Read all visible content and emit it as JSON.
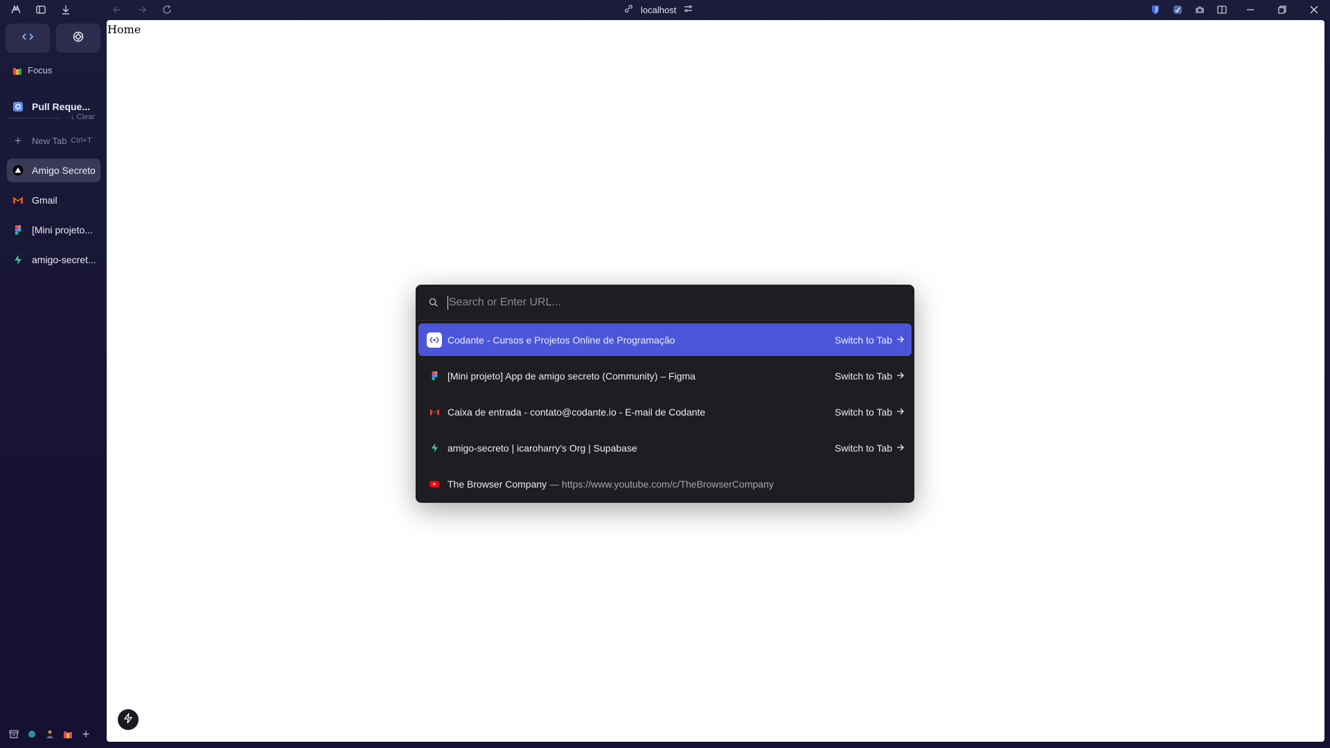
{
  "topbar": {
    "url": "localhost"
  },
  "sidebar": {
    "space_label": "Focus",
    "pinned_title": "Pull Reque...",
    "clear_label": "Clear",
    "new_tab_label": "New Tab",
    "new_tab_shortcut": "Ctrl+T",
    "tabs": [
      {
        "label": "Amigo Secreto",
        "icon": "triangle-logo-icon",
        "active": true
      },
      {
        "label": "Gmail",
        "icon": "gmail-icon",
        "active": false
      },
      {
        "label": "[Mini projeto...",
        "icon": "figma-icon",
        "active": false
      },
      {
        "label": "amigo-secret...",
        "icon": "supabase-icon",
        "active": false
      }
    ]
  },
  "page": {
    "home_text": "Home"
  },
  "command_bar": {
    "placeholder": "Search or Enter URL...",
    "results": [
      {
        "title": "Codante - Cursos e Projetos Online de Programação",
        "subtitle": "",
        "action": "Switch to Tab",
        "icon": "codante-icon",
        "selected": true
      },
      {
        "title": "[Mini projeto] App de amigo secreto (Community) – Figma",
        "subtitle": "",
        "action": "Switch to Tab",
        "icon": "figma-icon",
        "selected": false
      },
      {
        "title": "Caixa de entrada - contato@codante.io - E-mail de Codante",
        "subtitle": "",
        "action": "Switch to Tab",
        "icon": "gmail-icon",
        "selected": false
      },
      {
        "title": "amigo-secreto | icaroharry's Org | Supabase",
        "subtitle": "",
        "action": "Switch to Tab",
        "icon": "supabase-icon",
        "selected": false
      },
      {
        "title": "The Browser Company",
        "subtitle": "— https://www.youtube.com/c/TheBrowserCompany",
        "action": "",
        "icon": "youtube-icon",
        "selected": false
      }
    ]
  },
  "colors": {
    "sidebar_bg": "#1b1b3a",
    "selected_row": "#4b55d8",
    "command_bg": "#1d1d22"
  }
}
